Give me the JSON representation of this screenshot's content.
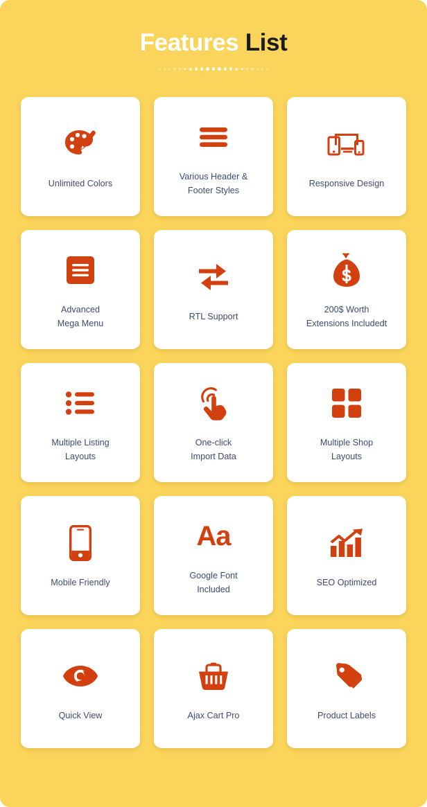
{
  "header": {
    "title_light": "Features",
    "title_dark": "List",
    "divider_dot_count": 21
  },
  "theme": {
    "background": "#FBD45C",
    "card_background": "#FFFFFF",
    "icon_color": "#D2400F",
    "label_color": "#3E4B6E",
    "title_light_color": "#FFFFFF",
    "title_dark_color": "#1B1B1B"
  },
  "features": [
    {
      "id": "unlimited-colors",
      "label": "Unlimited Colors",
      "icon": "palette-icon"
    },
    {
      "id": "header-footer",
      "label": "Various Header &\nFooter Styles",
      "icon": "hamburger-bars-icon"
    },
    {
      "id": "responsive-design",
      "label": "Responsive Design",
      "icon": "responsive-devices-icon"
    },
    {
      "id": "mega-menu",
      "label": "Advanced\nMega Menu",
      "icon": "menu-square-icon"
    },
    {
      "id": "rtl-support",
      "label": "RTL Support",
      "icon": "two-way-arrows-icon"
    },
    {
      "id": "extensions",
      "label": "200$ Worth\nExtensions Includedt",
      "icon": "money-bag-icon"
    },
    {
      "id": "listing-layouts",
      "label": "Multiple Listing\nLayouts",
      "icon": "bulleted-list-icon"
    },
    {
      "id": "one-click-import",
      "label": "One-click\nImport Data",
      "icon": "click-hand-icon"
    },
    {
      "id": "shop-layouts",
      "label": "Multiple Shop\nLayouts",
      "icon": "grid-squares-icon"
    },
    {
      "id": "mobile-friendly",
      "label": "Mobile Friendly",
      "icon": "smartphone-icon"
    },
    {
      "id": "google-font",
      "label": "Google Font\nIncluded",
      "icon": "typography-aa-icon",
      "glyph": "Aa"
    },
    {
      "id": "seo-optimized",
      "label": "SEO Optimized",
      "icon": "growth-chart-icon"
    },
    {
      "id": "quick-view",
      "label": "Quick View",
      "icon": "eye-icon"
    },
    {
      "id": "ajax-cart",
      "label": "Ajax Cart Pro",
      "icon": "shopping-basket-icon"
    },
    {
      "id": "product-labels",
      "label": "Product Labels",
      "icon": "price-tags-icon"
    }
  ]
}
